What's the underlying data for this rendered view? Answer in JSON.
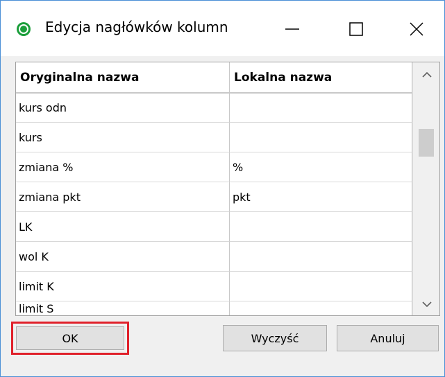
{
  "window": {
    "title": "Edycja nagłówków kolumn"
  },
  "grid": {
    "headers": [
      "Oryginalna nazwa",
      "Lokalna nazwa"
    ],
    "rows": [
      {
        "original": "kurs odn",
        "local": ""
      },
      {
        "original": "kurs",
        "local": ""
      },
      {
        "original": "zmiana %",
        "local": "%"
      },
      {
        "original": "zmiana pkt",
        "local": "pkt"
      },
      {
        "original": "LK",
        "local": ""
      },
      {
        "original": "wol K",
        "local": ""
      },
      {
        "original": "limit K",
        "local": ""
      },
      {
        "original": "limit S",
        "local": ""
      }
    ]
  },
  "buttons": {
    "ok": "OK",
    "clear": "Wyczyść",
    "cancel": "Anuluj"
  },
  "colors": {
    "app_icon": "#1a9e3a",
    "highlight": "#e0202a",
    "window_border": "#4a8fd6"
  },
  "icons": {
    "app": "app-icon",
    "minimize": "minimize-icon",
    "maximize": "maximize-icon",
    "close": "close-icon",
    "scroll_up": "chevron-up-icon",
    "scroll_down": "chevron-down-icon"
  }
}
